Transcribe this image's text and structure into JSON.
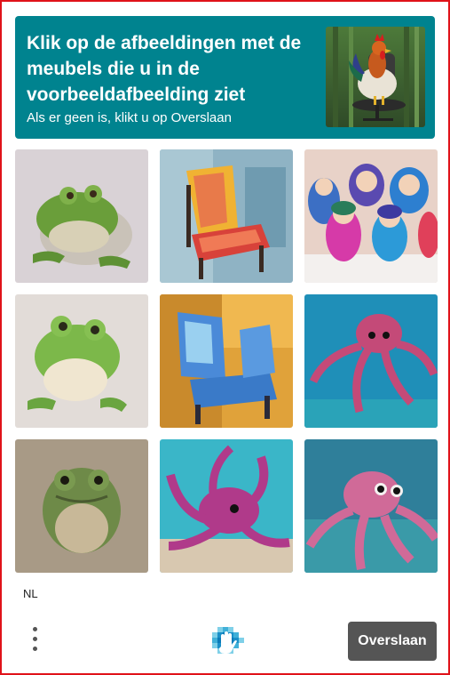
{
  "header": {
    "prompt": "Klik op de afbeeldingen met de meubels die u in de voorbeeldafbeelding ziet",
    "subprompt": "Als er geen is, klikt u op Overslaan",
    "example_image": "rooster-on-office-chair"
  },
  "grid": {
    "tiles": [
      {
        "subject": "frog"
      },
      {
        "subject": "chair"
      },
      {
        "subject": "nesting-dolls"
      },
      {
        "subject": "frog"
      },
      {
        "subject": "chair"
      },
      {
        "subject": "octopus"
      },
      {
        "subject": "frog"
      },
      {
        "subject": "octopus"
      },
      {
        "subject": "octopus"
      }
    ]
  },
  "footer": {
    "language": "NL",
    "menu_icon": "more-vertical-icon",
    "logo_icon": "hcaptcha-hand-icon",
    "skip_label": "Overslaan"
  },
  "colors": {
    "header_bg": "#00838f",
    "skip_bg": "#555555",
    "frame_border": "#e0121a"
  }
}
